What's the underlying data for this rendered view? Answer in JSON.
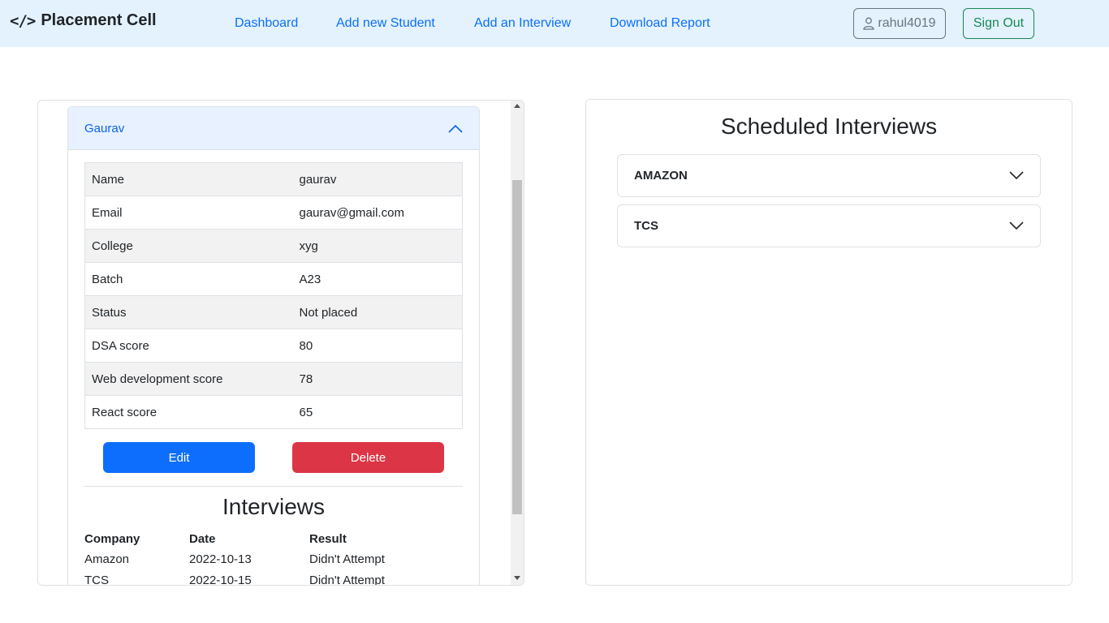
{
  "navbar": {
    "brand": "Placement Cell",
    "brand_icon": "code-icon",
    "links": [
      "Dashboard",
      "Add new Student",
      "Add an Interview",
      "Download Report"
    ],
    "username": "rahul4019",
    "user_icon": "person-icon",
    "signout_label": "Sign Out"
  },
  "student": {
    "name_header": "Gaurav",
    "details": [
      {
        "key": "Name",
        "value": "gaurav"
      },
      {
        "key": "Email",
        "value": "gaurav@gmail.com"
      },
      {
        "key": "College",
        "value": "xyg"
      },
      {
        "key": "Batch",
        "value": "A23"
      },
      {
        "key": "Status",
        "value": "Not placed"
      },
      {
        "key": "DSA score",
        "value": "80"
      },
      {
        "key": "Web development score",
        "value": "78"
      },
      {
        "key": "React score",
        "value": "65"
      }
    ],
    "edit_label": "Edit",
    "delete_label": "Delete",
    "interviews_title": "Interviews",
    "interview_headers": [
      "Company",
      "Date",
      "Result"
    ],
    "interviews": [
      {
        "company": "Amazon",
        "date": "2022-10-13",
        "result": "Didn't Attempt"
      },
      {
        "company": "TCS",
        "date": "2022-10-15",
        "result": "Didn't Attempt"
      }
    ]
  },
  "scheduled": {
    "title": "Scheduled Interviews",
    "companies": [
      "AMAZON",
      "TCS"
    ]
  },
  "colors": {
    "navbar_bg": "#e3f2fd",
    "link": "#0d6efd",
    "accordion_header_bg": "#e7f1ff",
    "edit": "#0d6efd",
    "delete": "#dc3545",
    "signout": "#198754"
  }
}
